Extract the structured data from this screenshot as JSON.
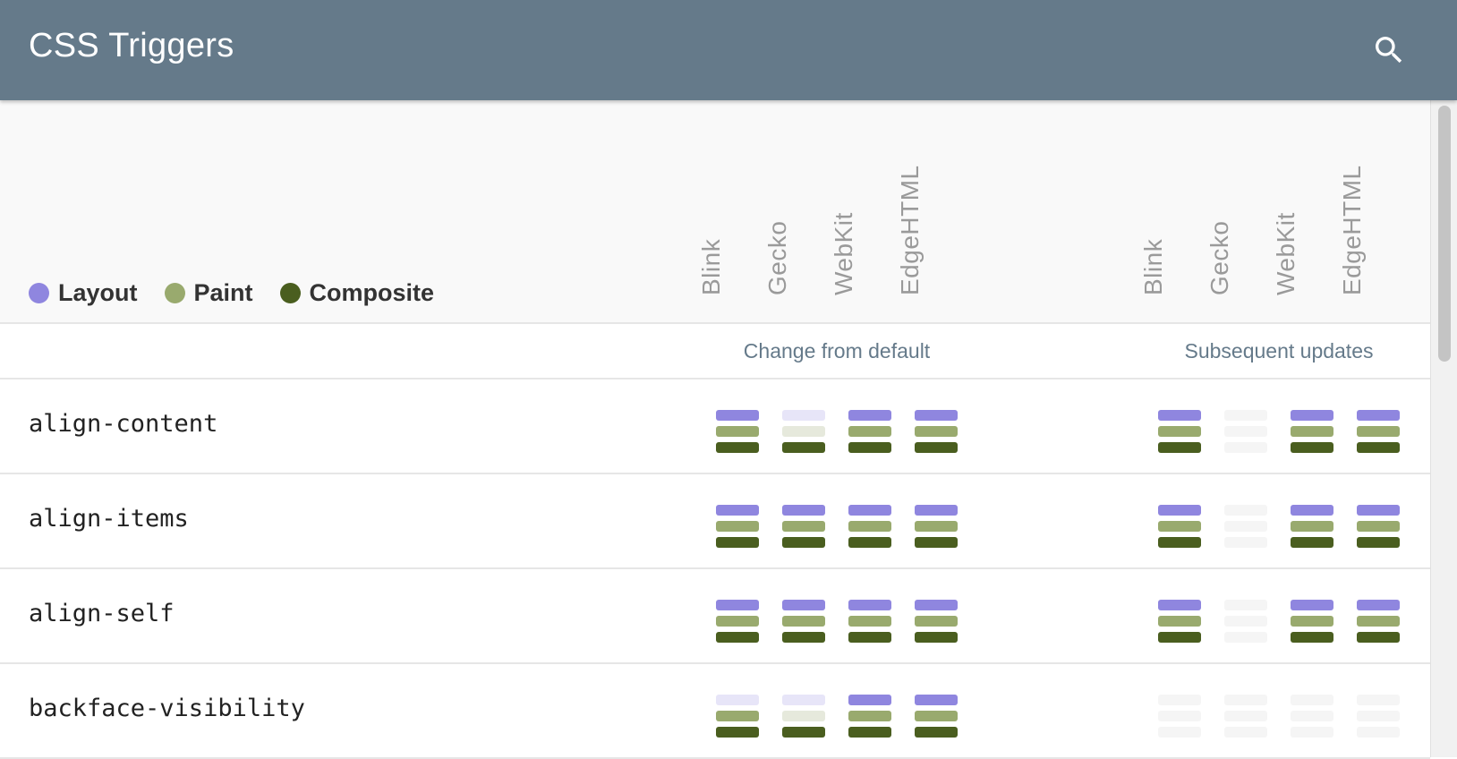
{
  "app": {
    "title": "CSS Triggers",
    "search_icon": "search-icon"
  },
  "legend": [
    {
      "label": "Layout",
      "color": "#8f86df"
    },
    {
      "label": "Paint",
      "color": "#99aa6e"
    },
    {
      "label": "Composite",
      "color": "#4a5e1f"
    }
  ],
  "engines": [
    "Blink",
    "Gecko",
    "WebKit",
    "EdgeHTML"
  ],
  "groups": [
    "Change from default",
    "Subsequent updates"
  ],
  "colors": {
    "layout_on": "#8f86df",
    "layout_off": "#e7e5f8",
    "paint_on": "#99aa6e",
    "paint_off": "#e6e9dc",
    "composite_on": "#4a5e1f",
    "composite_off": "#dfe3d4",
    "blank": "#f5f5f5"
  },
  "properties": [
    {
      "name": "align-content",
      "change": [
        [
          1,
          1,
          1
        ],
        [
          0,
          0,
          1
        ],
        [
          1,
          1,
          1
        ],
        [
          1,
          1,
          1
        ]
      ],
      "subsequent": [
        [
          1,
          1,
          1
        ],
        null,
        [
          1,
          1,
          1
        ],
        [
          1,
          1,
          1
        ]
      ]
    },
    {
      "name": "align-items",
      "change": [
        [
          1,
          1,
          1
        ],
        [
          1,
          1,
          1
        ],
        [
          1,
          1,
          1
        ],
        [
          1,
          1,
          1
        ]
      ],
      "subsequent": [
        [
          1,
          1,
          1
        ],
        null,
        [
          1,
          1,
          1
        ],
        [
          1,
          1,
          1
        ]
      ]
    },
    {
      "name": "align-self",
      "change": [
        [
          1,
          1,
          1
        ],
        [
          1,
          1,
          1
        ],
        [
          1,
          1,
          1
        ],
        [
          1,
          1,
          1
        ]
      ],
      "subsequent": [
        [
          1,
          1,
          1
        ],
        null,
        [
          1,
          1,
          1
        ],
        [
          1,
          1,
          1
        ]
      ]
    },
    {
      "name": "backface-visibility",
      "change": [
        [
          0,
          1,
          1
        ],
        [
          0,
          0,
          1
        ],
        [
          1,
          1,
          1
        ],
        [
          1,
          1,
          1
        ]
      ],
      "subsequent": [
        null,
        null,
        null,
        null
      ]
    }
  ]
}
